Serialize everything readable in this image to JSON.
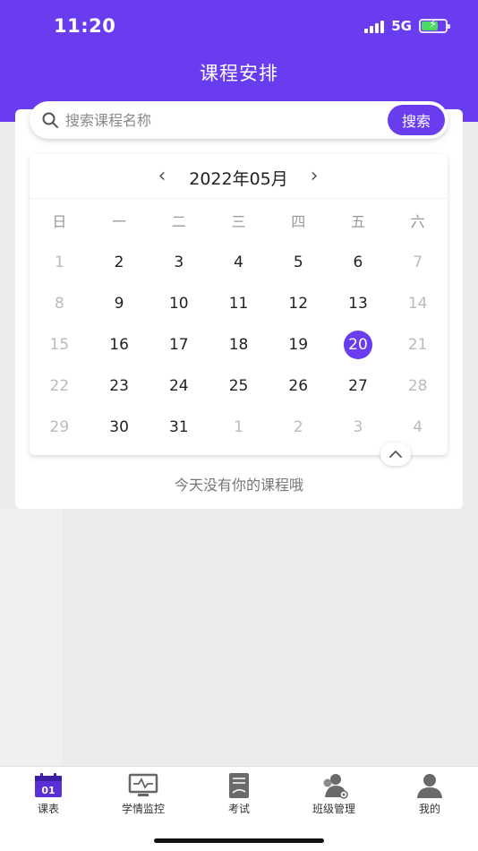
{
  "status_bar": {
    "time": "11:20",
    "network": "5G"
  },
  "header": {
    "title": "课程安排"
  },
  "search": {
    "placeholder": "搜索课程名称",
    "button_label": "搜索"
  },
  "calendar": {
    "month_label": "2022年05月",
    "weekdays": [
      "日",
      "一",
      "二",
      "三",
      "四",
      "五",
      "六"
    ],
    "weeks": [
      [
        {
          "d": "1",
          "m": true
        },
        {
          "d": "2"
        },
        {
          "d": "3"
        },
        {
          "d": "4"
        },
        {
          "d": "5"
        },
        {
          "d": "6"
        },
        {
          "d": "7",
          "m": true
        }
      ],
      [
        {
          "d": "8",
          "m": true
        },
        {
          "d": "9"
        },
        {
          "d": "10"
        },
        {
          "d": "11"
        },
        {
          "d": "12"
        },
        {
          "d": "13"
        },
        {
          "d": "14",
          "m": true
        }
      ],
      [
        {
          "d": "15",
          "m": true
        },
        {
          "d": "16"
        },
        {
          "d": "17"
        },
        {
          "d": "18"
        },
        {
          "d": "19"
        },
        {
          "d": "20",
          "s": true
        },
        {
          "d": "21",
          "m": true
        }
      ],
      [
        {
          "d": "22",
          "m": true
        },
        {
          "d": "23"
        },
        {
          "d": "24"
        },
        {
          "d": "25"
        },
        {
          "d": "26"
        },
        {
          "d": "27"
        },
        {
          "d": "28",
          "m": true
        }
      ],
      [
        {
          "d": "29",
          "m": true
        },
        {
          "d": "30"
        },
        {
          "d": "31"
        },
        {
          "d": "1",
          "m": true
        },
        {
          "d": "2",
          "m": true
        },
        {
          "d": "3",
          "m": true
        },
        {
          "d": "4",
          "m": true
        }
      ]
    ],
    "selected_day": "20"
  },
  "empty_message": "今天没有你的课程哦",
  "tabbar": {
    "calendar_icon_text": "01",
    "items": [
      {
        "label": "课表",
        "icon": "calendar-icon"
      },
      {
        "label": "学情监控",
        "icon": "monitor-icon"
      },
      {
        "label": "考试",
        "icon": "exam-paper-icon"
      },
      {
        "label": "班级管理",
        "icon": "class-management-icon"
      },
      {
        "label": "我的",
        "icon": "profile-icon"
      }
    ]
  },
  "colors": {
    "accent": "#6a3cf0",
    "background": "#ececec"
  }
}
